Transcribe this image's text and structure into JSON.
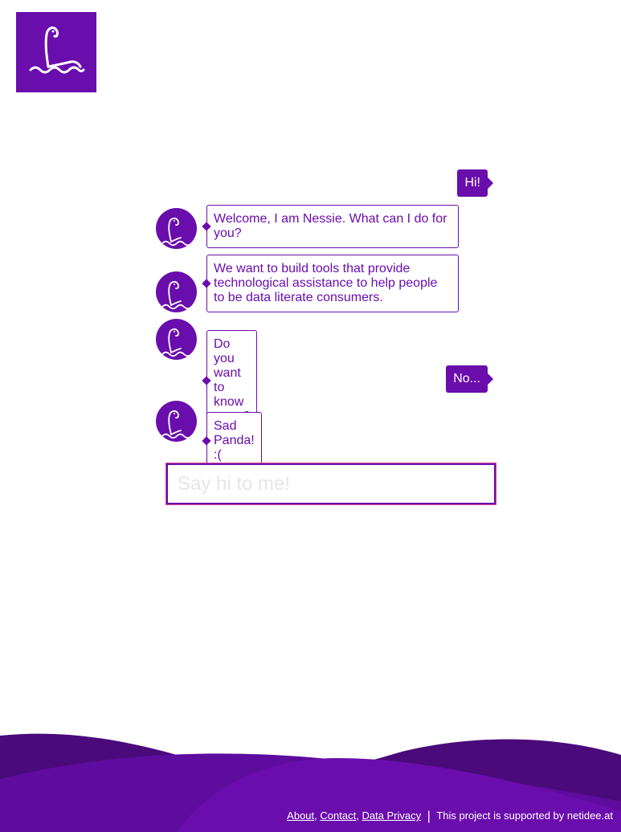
{
  "app": {
    "logo_icon": "nessie-logo-icon",
    "brand_color": "#6a0dad"
  },
  "chat": {
    "messages": [
      {
        "from": "user",
        "text": "Hi!"
      },
      {
        "from": "bot",
        "text": "Welcome, I am Nessie. What can I do for you?"
      },
      {
        "from": "bot",
        "text": "We want to build tools that provide technological assistance to help people to be data literate consumers."
      },
      {
        "from": "bot",
        "text": "Do you want to know more?"
      },
      {
        "from": "user",
        "text": "No..."
      },
      {
        "from": "bot",
        "text": "Sad Panda! :("
      }
    ],
    "avatar_icon": "nessie-avatar-icon"
  },
  "input": {
    "placeholder": "Say hi to me!",
    "value": ""
  },
  "footer": {
    "links": [
      "About",
      "Contact",
      "Data Privacy"
    ],
    "separator": "|",
    "support_text": "This project is supported by netidee.at"
  }
}
